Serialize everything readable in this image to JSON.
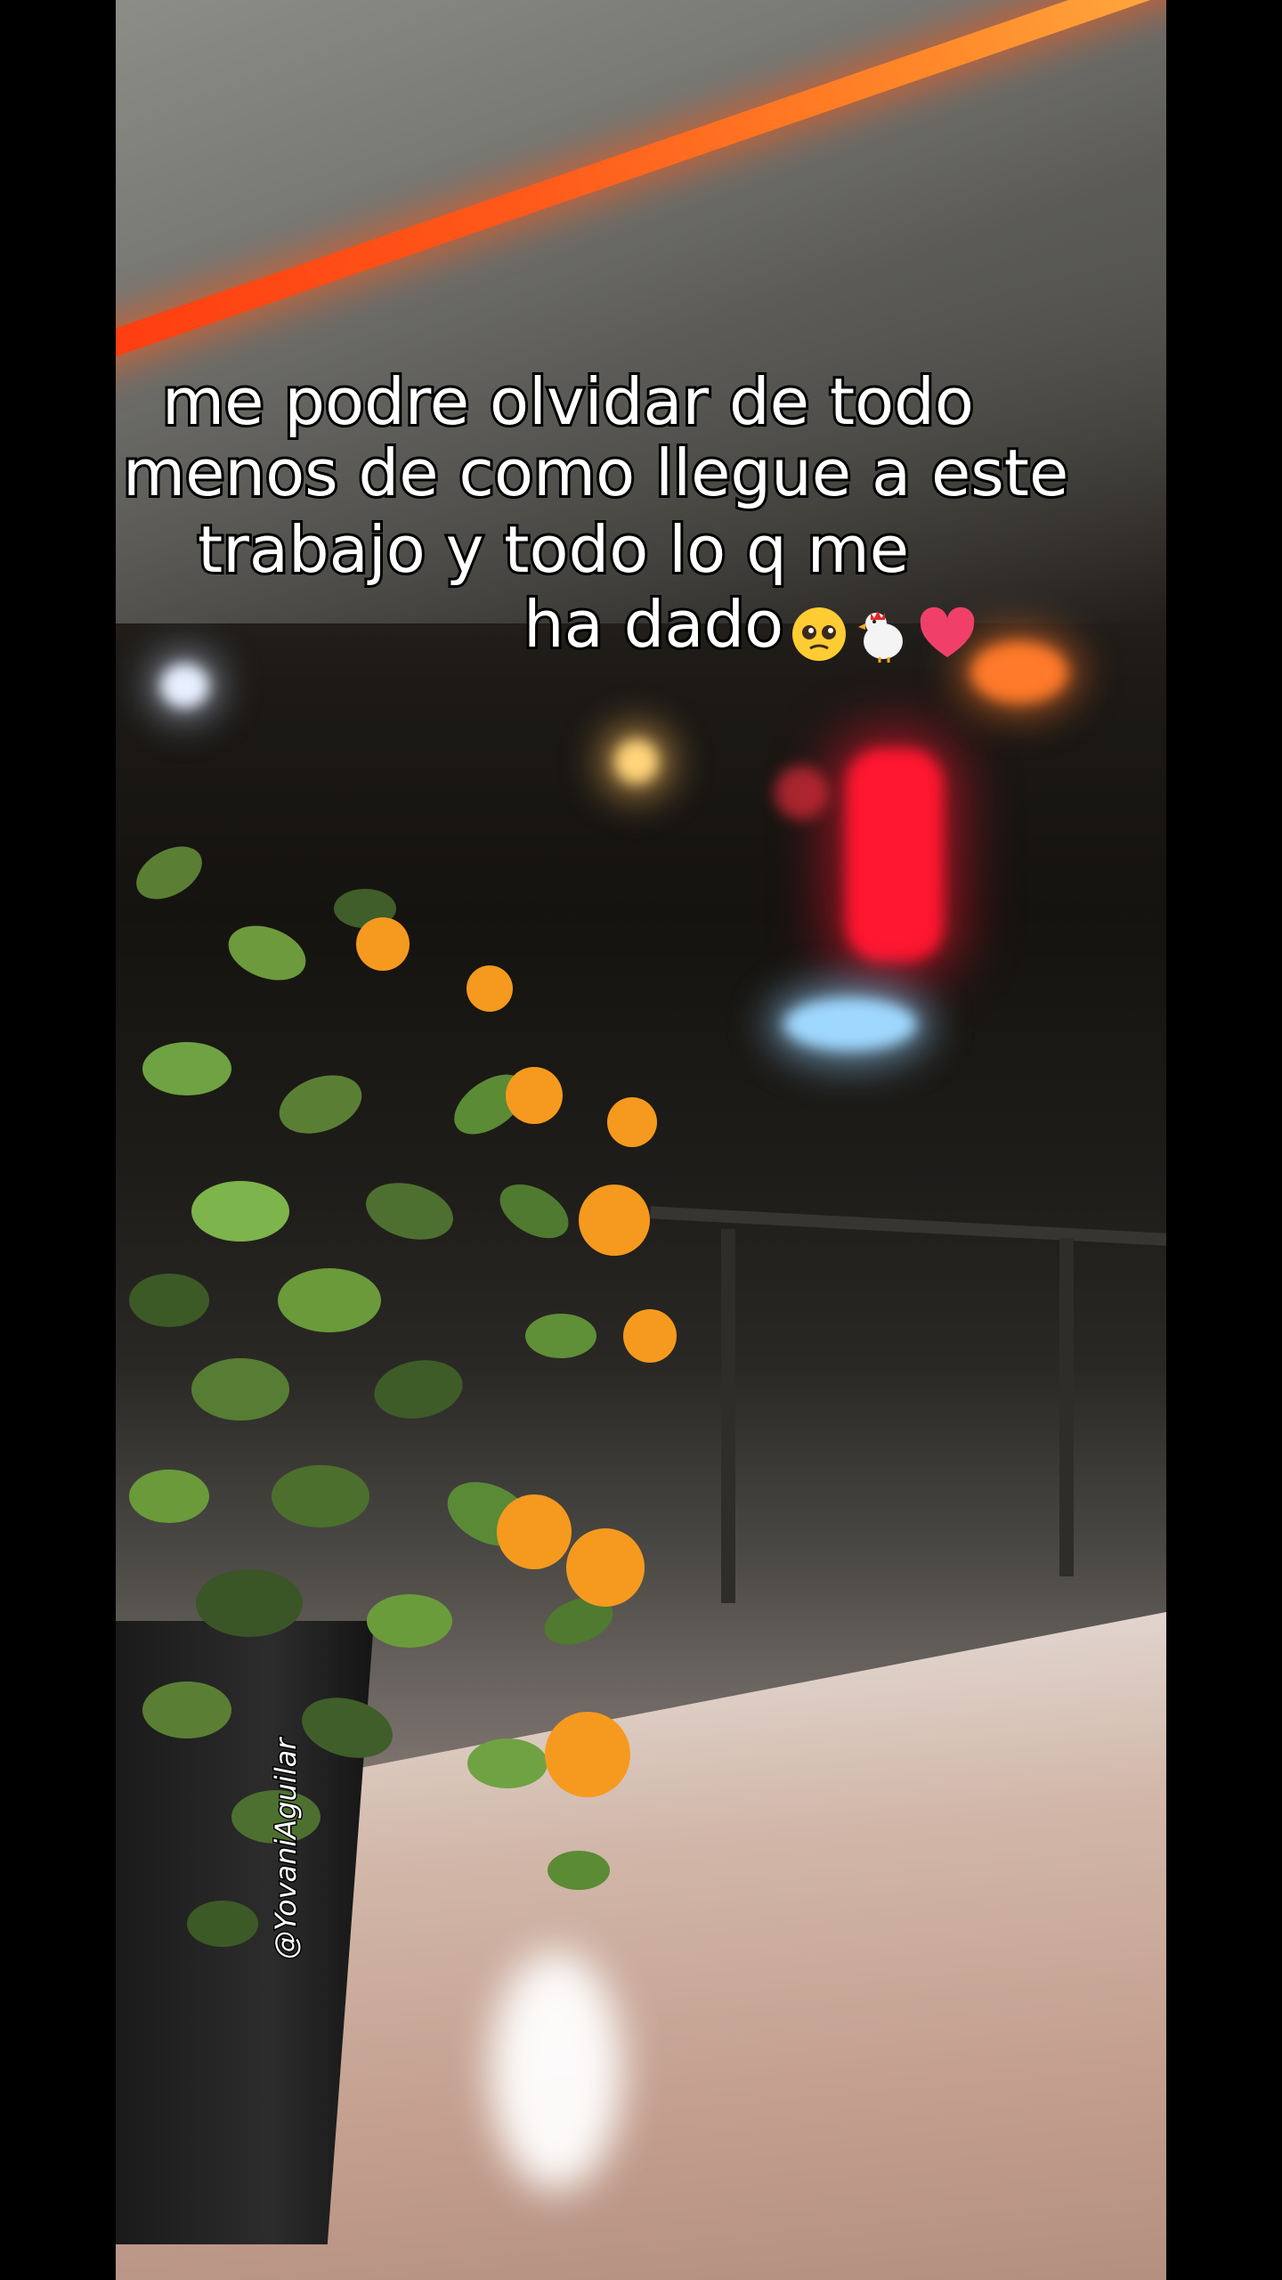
{
  "caption": {
    "line1": "me podre olvidar de todo",
    "line2": "menos de como llegue a este",
    "line3": "trabajo y todo lo q me",
    "line4": "ha dado"
  },
  "emojis": [
    "pleading-face-icon",
    "rooster-icon",
    "heart-icon"
  ],
  "watermark": "@YovaniAguilar",
  "colors": {
    "neon": "#ff4a14",
    "sign_red": "#ff1630",
    "caption_text": "#ffffff",
    "caption_stroke": "#000000",
    "leaf_green": "#5e8f3a",
    "flower_orange": "#f59a1e"
  }
}
